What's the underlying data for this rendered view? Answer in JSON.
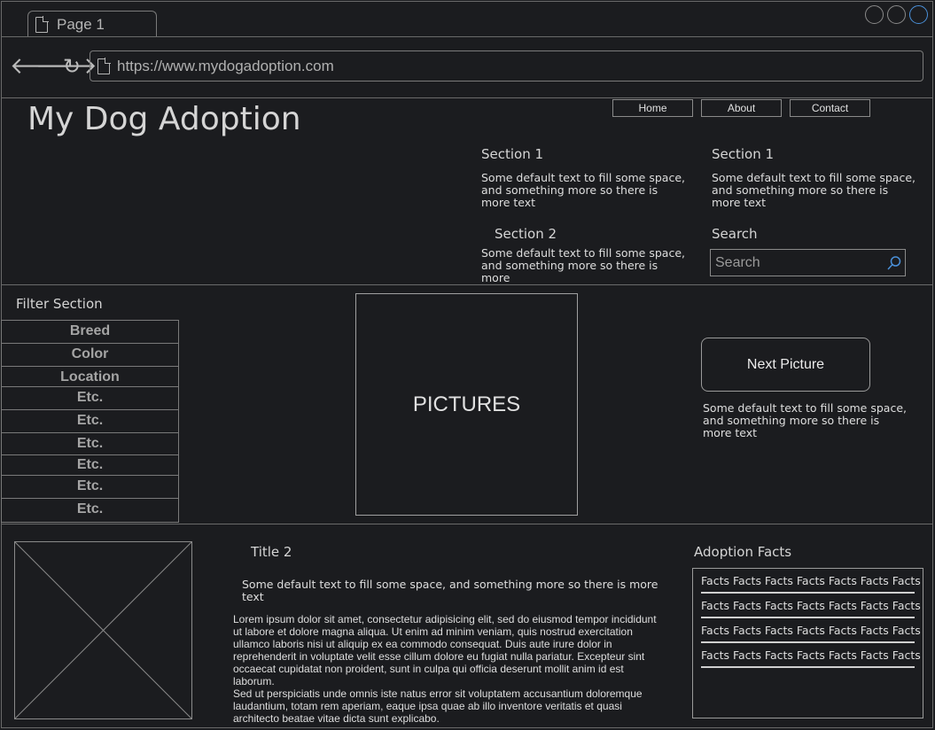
{
  "browser": {
    "tab_label": "Page 1",
    "url": "https://www.mydogadoption.com"
  },
  "header": {
    "site_title": "My Dog Adoption",
    "nav": [
      "Home",
      "About",
      "Contact"
    ],
    "sections": [
      {
        "title": "Section 1",
        "text": "Some default text to fill some space, and something more so there is more text"
      },
      {
        "title": "Section 1",
        "text": "Some default text to fill some space, and something more so there is more text"
      },
      {
        "title": "Section 2",
        "text": "Some default text to fill some space, and something more so there is more"
      }
    ],
    "search_title": "Search",
    "search_placeholder": "Search"
  },
  "filter": {
    "title": "Filter Section",
    "items": [
      "Breed",
      "Color",
      "Location",
      "Etc.",
      "Etc.",
      "Etc.",
      "Etc.",
      "Etc.",
      "Etc."
    ]
  },
  "gallery": {
    "pictures_label": "PICTURES",
    "next_button": "Next Picture",
    "caption": "Some default text to fill some space, and something more so there is more text"
  },
  "content": {
    "title": "Title 2",
    "subtitle": "Some default text to fill some space, and something more so there is more text",
    "body": "Lorem ipsum dolor sit amet, consectetur adipisicing elit, sed do eiusmod tempor incididunt ut labore et dolore magna aliqua. Ut enim ad minim veniam, quis nostrud exercitation ullamco laboris nisi ut aliquip ex ea commodo consequat. Duis aute irure dolor in reprehenderit in voluptate velit esse cillum dolore eu fugiat nulla pariatur. Excepteur sint occaecat cupidatat non proident, sunt in culpa qui officia deserunt mollit anim id est laborum.",
    "body2": "Sed ut perspiciatis unde omnis iste natus error sit voluptatem accusantium doloremque laudantium, totam rem aperiam, eaque ipsa quae ab illo inventore veritatis et quasi architecto beatae vitae dicta sunt explicabo."
  },
  "facts": {
    "title": "Adoption Facts",
    "rows": [
      "Facts Facts Facts Facts Facts Facts Facts",
      "Facts Facts Facts Facts Facts Facts Facts",
      "Facts Facts Facts Facts Facts Facts Facts",
      "Facts Facts Facts Facts Facts Facts Facts"
    ]
  }
}
